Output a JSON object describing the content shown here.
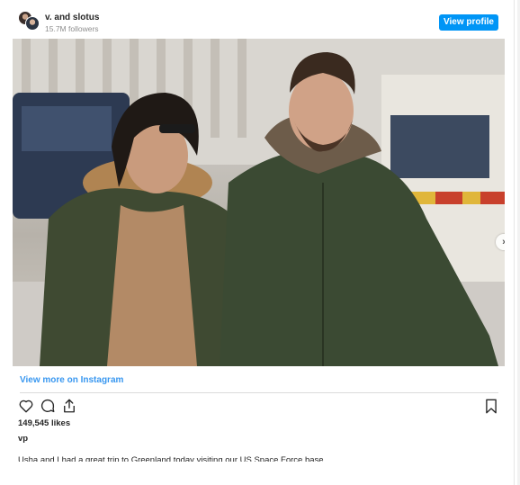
{
  "header": {
    "username": "v.  and slotus",
    "followers": "15.7M followers",
    "view_profile_label": "View profile"
  },
  "photo": {
    "description_icon": "photo-carousel",
    "carousel_dots": 4,
    "active_dot": 1,
    "next_label": "›"
  },
  "links": {
    "view_more": "View more on Instagram"
  },
  "actions": {
    "like_icon": "heart-icon",
    "comment_icon": "comment-icon",
    "share_icon": "share-icon",
    "save_icon": "bookmark-icon"
  },
  "post": {
    "likes": "149,545 likes",
    "author": "vp",
    "caption": "Usha and I had a great trip to Greenland today visiting our US Space Force base"
  },
  "colors": {
    "accent": "#0095f6",
    "link": "#3897f0",
    "text": "#262626",
    "muted": "#8e8e8e"
  }
}
